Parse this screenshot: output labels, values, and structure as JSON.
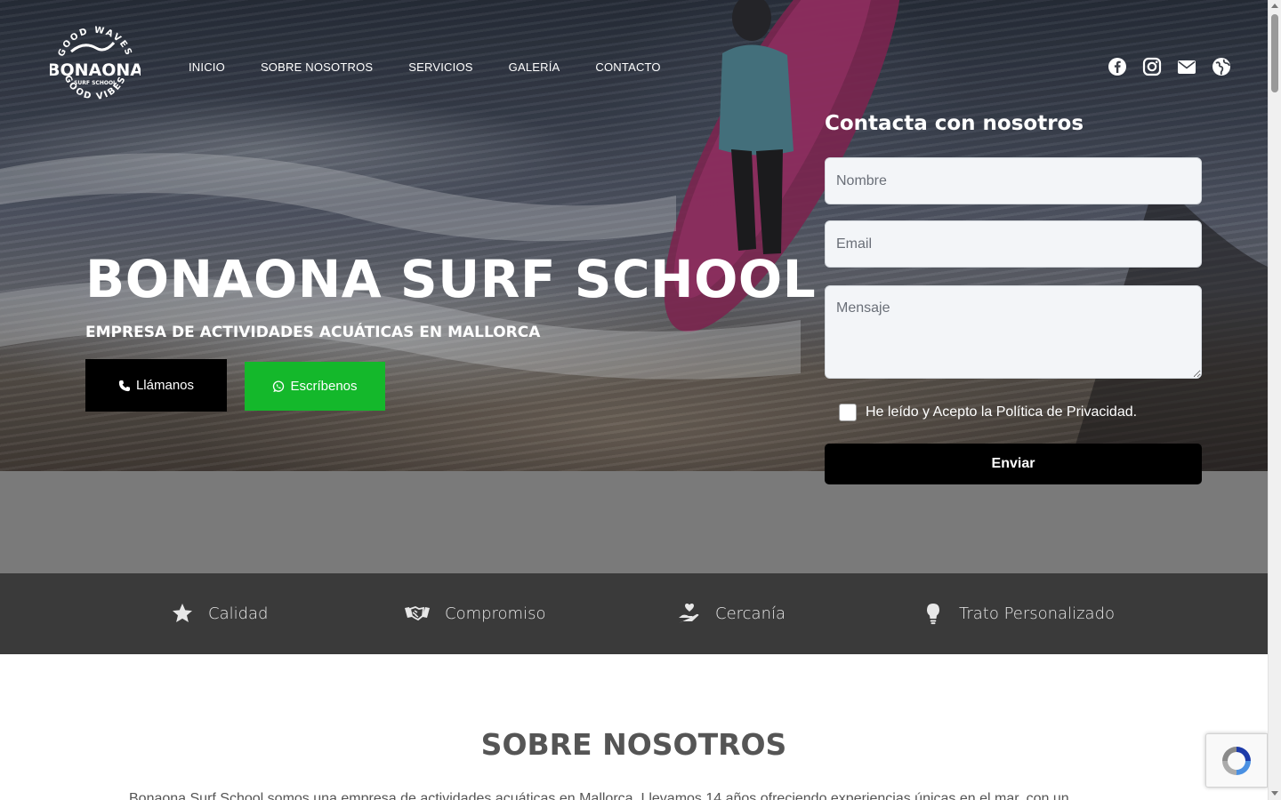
{
  "logo": {
    "top_text": "GOOD WAVES",
    "brand": "BONAONA",
    "tagline": "SURF SCHOOL",
    "bottom_text": "GOOD VIBES"
  },
  "nav": {
    "items": [
      {
        "label": "INICIO"
      },
      {
        "label": "SOBRE NOSOTROS"
      },
      {
        "label": "SERVICIOS"
      },
      {
        "label": "GALERÍA"
      },
      {
        "label": "CONTACTO"
      }
    ]
  },
  "socials": [
    "facebook-icon",
    "instagram-icon",
    "envelope-icon",
    "globe-icon"
  ],
  "hero": {
    "title": "BONAONA SURF SCHOOL",
    "subtitle": "EMPRESA DE ACTIVIDADES ACUÁTICAS EN MALLORCA",
    "call_label": "Llámanos",
    "whatsapp_label": "Escríbenos"
  },
  "contact_form": {
    "title": "Contacta con nosotros",
    "name_placeholder": "Nombre",
    "email_placeholder": "Email",
    "message_placeholder": "Mensaje",
    "privacy_label": "He leído y Acepto la Política de Privacidad.",
    "submit_label": "Enviar"
  },
  "values": [
    {
      "label": "Calidad",
      "icon": "star-icon"
    },
    {
      "label": "Compromiso",
      "icon": "handshake-icon"
    },
    {
      "label": "Cercanía",
      "icon": "hand-heart-icon"
    },
    {
      "label": "Trato Personalizado",
      "icon": "lightbulb-icon"
    }
  ],
  "about": {
    "title": "SOBRE NOSOTROS",
    "text": "Bonaona Surf School somos una empresa de actividades acuáticas en Mallorca. Llevamos 14 años ofreciendo experiencias únicas en el mar, con un"
  },
  "colors": {
    "whatsapp_green": "#14b82b",
    "values_bar": "#3a3a3a",
    "grey_band": "#7a7a7a"
  }
}
